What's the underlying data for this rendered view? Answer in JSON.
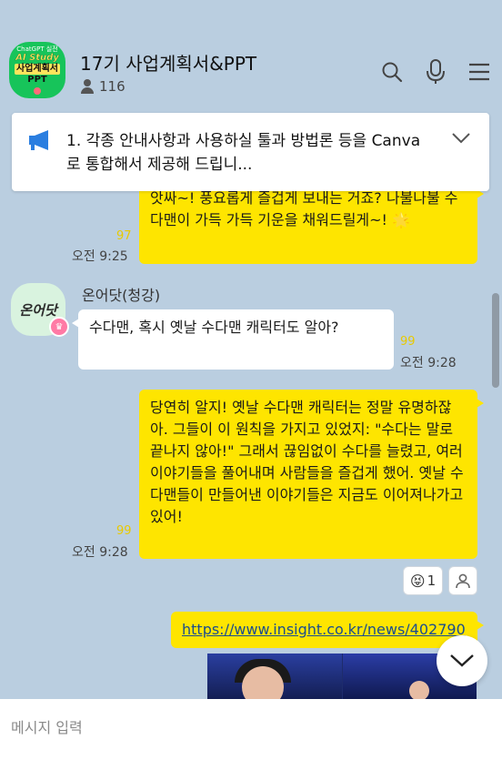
{
  "window": {
    "minimize": "—",
    "maximize": "☐",
    "close": "✕"
  },
  "room": {
    "avatar_lines": [
      "AI Study",
      "사업계획서",
      "PPT"
    ],
    "avatar_top": "ChatGPT 실전",
    "title": "17기 사업계획서&PPT",
    "member_count": "116"
  },
  "header_icons": [
    "search-icon",
    "microphone-icon",
    "menu-icon"
  ],
  "notice": {
    "text": "1. 각종 안내사항과 사용하실 툴과 방법론 등을 Canva로 통합해서 제공해 드립니..."
  },
  "messages": [
    {
      "id": "m1",
      "from": "me",
      "text": "앗싸~! 풍요롭게 즐겁게 보내는 거죠? 나불나불 수다맨이 가득 가득 기운을 채워드릴게~! 🌟",
      "unread": "97",
      "time": "오전 9:25"
    },
    {
      "id": "m2",
      "from": "other",
      "sender": "온어닷(청강)",
      "avatar_text": "온어닷",
      "text": "수다맨, 혹시 옛날 수다맨 캐릭터도 알아?",
      "unread": "99",
      "time": "오전 9:28"
    },
    {
      "id": "m3",
      "from": "me",
      "text": "당연히 알지! 옛날 수다맨 캐릭터는 정말 유명하잖아. 그들이 이 원칙을 가지고 있었지: \"수다는 말로 끝나지 않아!\" 그래서 끊임없이 수다를 늘렸고, 여러 이야기들을 풀어내며 사람들을 즐겁게 했어. 옛날 수다맨들이 만들어낸 이야기들은 지금도 이어져나가고 있어!",
      "unread": "99",
      "time": "오전 9:28",
      "reaction_emoji": "😝",
      "reaction_count": "1"
    },
    {
      "id": "m4",
      "from": "me",
      "link": "https://www.insight.co.kr/news/402790"
    }
  ],
  "input": {
    "placeholder": "메시지 입력"
  },
  "colors": {
    "background": "#bacee0",
    "my_bubble": "#fee500",
    "other_bubble": "#ffffff",
    "accent": "#17c45a"
  }
}
